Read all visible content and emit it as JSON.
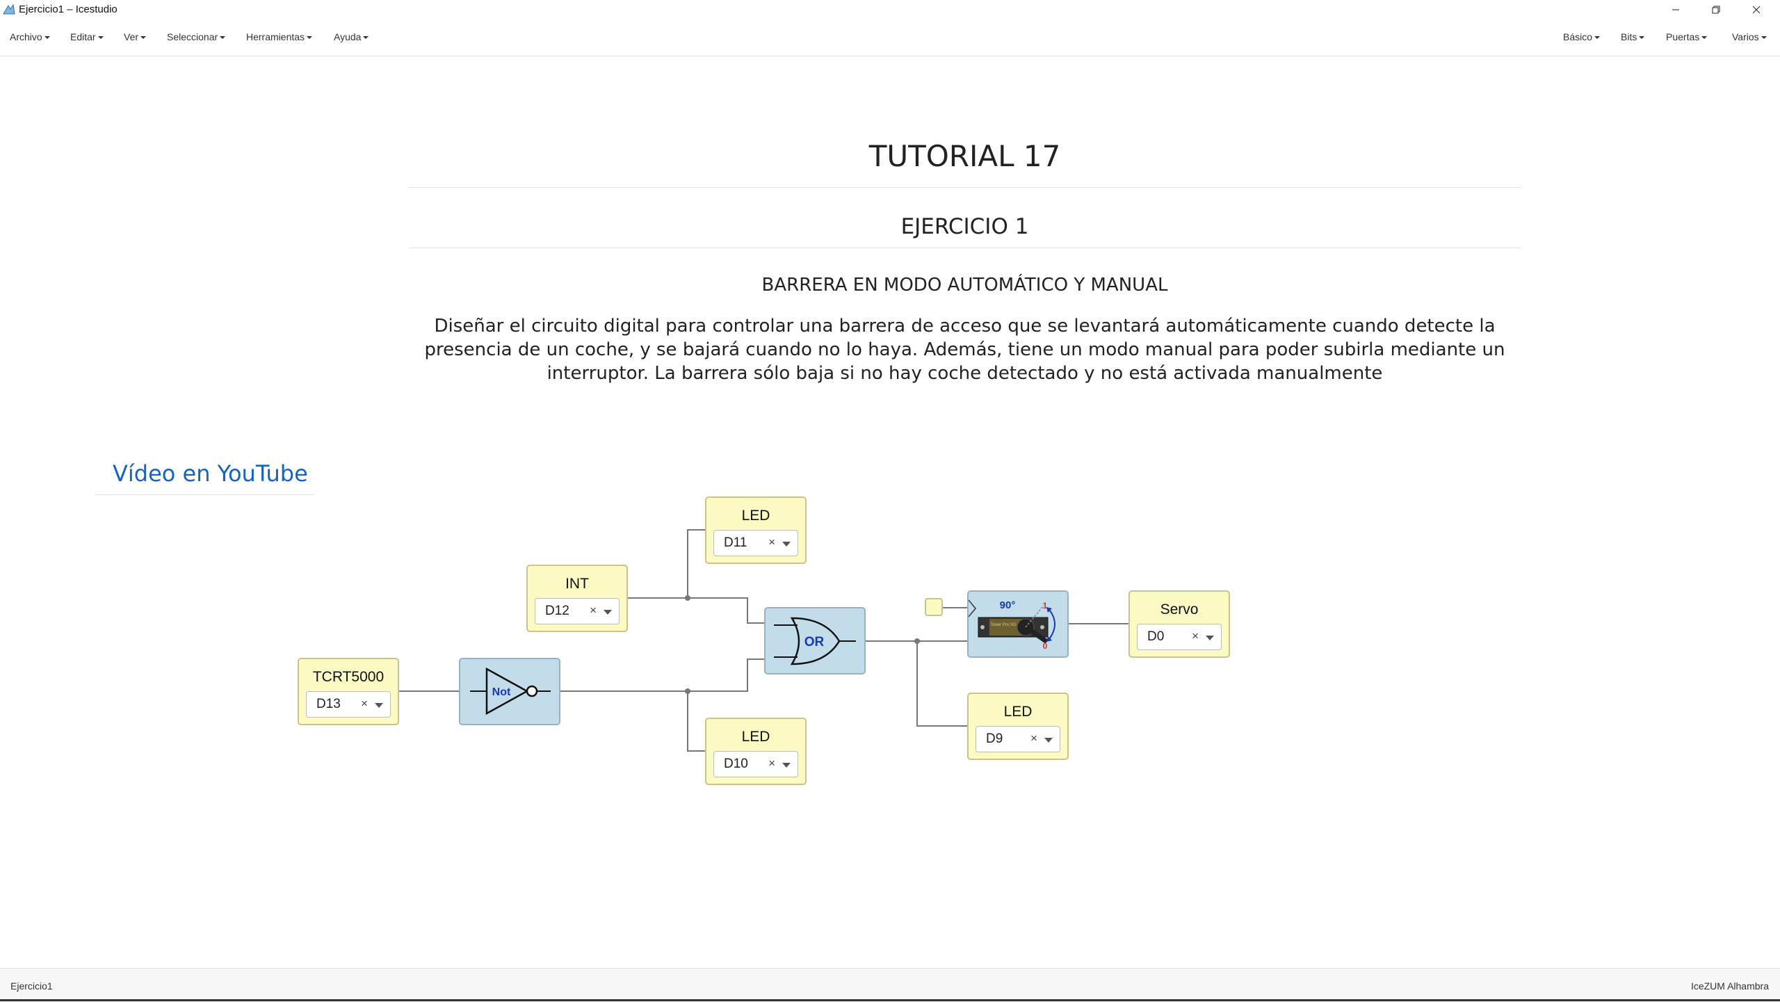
{
  "window": {
    "title": "Ejercicio1 – Icestudio"
  },
  "menu_left": [
    "Archivo",
    "Editar",
    "Ver",
    "Seleccionar",
    "Herramientas",
    "Ayuda"
  ],
  "menu_right": [
    "Básico",
    "Bits",
    "Puertas",
    "Varios"
  ],
  "info": {
    "title": "TUTORIAL 17",
    "exercise": "EJERCICIO 1",
    "subtitle": "BARRERA EN MODO AUTOMÁTICO Y MANUAL",
    "description": "Diseñar el circuito digital para controlar una barrera de acceso que se levantará automáticamente cuando detecte la presencia de un coche, y se bajará cuando no lo haya. Además, tiene un modo manual para poder subirla mediante un interruptor. La barrera sólo baja si no hay coche detectado y no está activada manualmente",
    "video_link": "Vídeo en YouTube"
  },
  "blocks": {
    "tcrt": {
      "label": "TCRT5000",
      "pin": "D13"
    },
    "int": {
      "label": "INT",
      "pin": "D12"
    },
    "led_top": {
      "label": "LED",
      "pin": "D11"
    },
    "led_bottom": {
      "label": "LED",
      "pin": "D10"
    },
    "led_out": {
      "label": "LED",
      "pin": "D9"
    },
    "servo": {
      "label": "Servo",
      "pin": "D0"
    },
    "not_gate": {
      "label": "Not"
    },
    "or_gate": {
      "label": "OR"
    },
    "servo_ctrl": {
      "angle_label": "90°",
      "high_label": "1",
      "low_label": "0",
      "component_text": "Tower Pro SG 90"
    }
  },
  "clear_symbol": "×",
  "status": {
    "left": "Ejercicio1",
    "right": "IceZUM Alhambra"
  },
  "colors": {
    "io_block": "#fafac2",
    "logic_block": "#c2dcea",
    "link": "#1565c0",
    "wire": "#777777"
  }
}
